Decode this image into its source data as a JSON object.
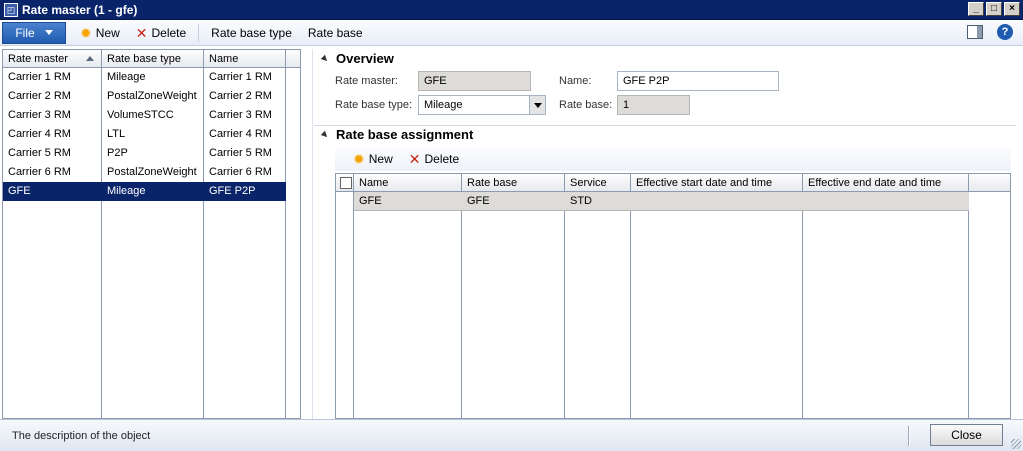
{
  "window": {
    "title": "Rate master (1 - gfe)",
    "controls": [
      "_",
      "□",
      "×"
    ]
  },
  "toolbar": {
    "file_label": "File",
    "new_label": "New",
    "delete_label": "Delete",
    "rate_base_type_label": "Rate base type",
    "rate_base_label": "Rate base",
    "help_label": "?"
  },
  "left_grid": {
    "columns": [
      "Rate master",
      "Rate base type",
      "Name"
    ],
    "rows": [
      [
        "Carrier 1 RM",
        "Mileage",
        "Carrier 1 RM"
      ],
      [
        "Carrier 2 RM",
        "PostalZoneWeight",
        "Carrier 2 RM"
      ],
      [
        "Carrier 3 RM",
        "VolumeSTCC",
        "Carrier 3 RM"
      ],
      [
        "Carrier 4 RM",
        "LTL",
        "Carrier 4 RM"
      ],
      [
        "Carrier 5 RM",
        "P2P",
        "Carrier 5 RM"
      ],
      [
        "Carrier 6 RM",
        "PostalZoneWeight",
        "Carrier 6 RM"
      ],
      [
        "GFE",
        "Mileage",
        "GFE P2P"
      ]
    ],
    "selected_row": 6
  },
  "overview": {
    "heading": "Overview",
    "rate_master_label": "Rate master:",
    "rate_master_value": "GFE",
    "name_label": "Name:",
    "name_value": "GFE P2P",
    "rate_base_type_label": "Rate base type:",
    "rate_base_type_value": "Mileage",
    "rate_base_label": "Rate base:",
    "rate_base_value": "1"
  },
  "assignment": {
    "heading": "Rate base assignment",
    "new_label": "New",
    "delete_label": "Delete",
    "columns": [
      "Name",
      "Rate base",
      "Service",
      "Effective start date and time",
      "Effective end date and time"
    ],
    "rows": [
      [
        "GFE",
        "GFE",
        "STD",
        "",
        ""
      ]
    ]
  },
  "statusbar": {
    "description": "The description of the object",
    "close_label": "Close"
  }
}
